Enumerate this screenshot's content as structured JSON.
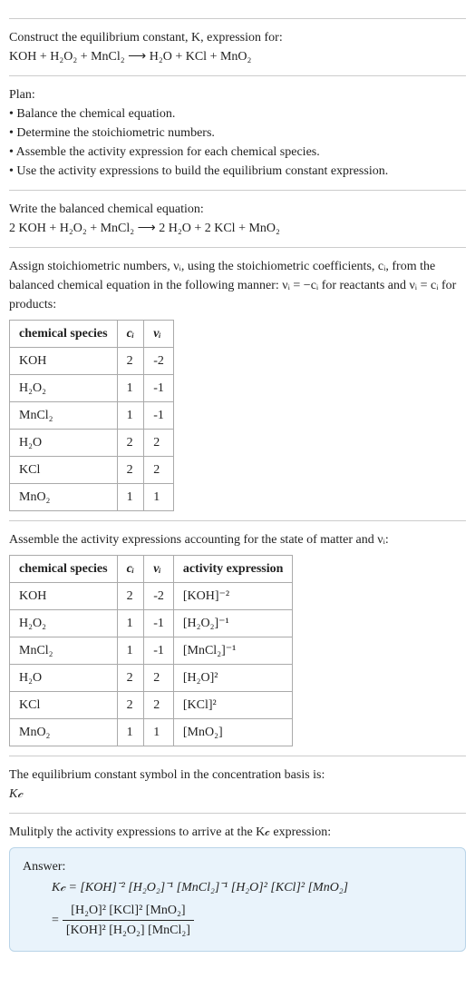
{
  "intro": {
    "line1": "Construct the equilibrium constant, K, expression for:",
    "reaction_unbal": "KOH + H₂O₂ + MnCl₂ ⟶ H₂O + KCl + MnO₂"
  },
  "plan": {
    "title": "Plan:",
    "bullets": [
      "Balance the chemical equation.",
      "Determine the stoichiometric numbers.",
      "Assemble the activity expression for each chemical species.",
      "Use the activity expressions to build the equilibrium constant expression."
    ]
  },
  "balanced": {
    "title": "Write the balanced chemical equation:",
    "equation": "2 KOH + H₂O₂ + MnCl₂ ⟶ 2 H₂O + 2 KCl + MnO₂"
  },
  "stoich": {
    "intro": "Assign stoichiometric numbers, νᵢ, using the stoichiometric coefficients, cᵢ, from the balanced chemical equation in the following manner: νᵢ = −cᵢ for reactants and νᵢ = cᵢ for products:",
    "headers": [
      "chemical species",
      "cᵢ",
      "νᵢ"
    ],
    "rows": [
      {
        "species": "KOH",
        "c": "2",
        "v": "-2"
      },
      {
        "species": "H₂O₂",
        "c": "1",
        "v": "-1"
      },
      {
        "species": "MnCl₂",
        "c": "1",
        "v": "-1"
      },
      {
        "species": "H₂O",
        "c": "2",
        "v": "2"
      },
      {
        "species": "KCl",
        "c": "2",
        "v": "2"
      },
      {
        "species": "MnO₂",
        "c": "1",
        "v": "1"
      }
    ]
  },
  "activity": {
    "intro": "Assemble the activity expressions accounting for the state of matter and νᵢ:",
    "headers": [
      "chemical species",
      "cᵢ",
      "νᵢ",
      "activity expression"
    ],
    "rows": [
      {
        "species": "KOH",
        "c": "2",
        "v": "-2",
        "expr": "[KOH]⁻²"
      },
      {
        "species": "H₂O₂",
        "c": "1",
        "v": "-1",
        "expr": "[H₂O₂]⁻¹"
      },
      {
        "species": "MnCl₂",
        "c": "1",
        "v": "-1",
        "expr": "[MnCl₂]⁻¹"
      },
      {
        "species": "H₂O",
        "c": "2",
        "v": "2",
        "expr": "[H₂O]²"
      },
      {
        "species": "KCl",
        "c": "2",
        "v": "2",
        "expr": "[KCl]²"
      },
      {
        "species": "MnO₂",
        "c": "1",
        "v": "1",
        "expr": "[MnO₂]"
      }
    ]
  },
  "symbol": {
    "line1": "The equilibrium constant symbol in the concentration basis is:",
    "line2": "K𝒸"
  },
  "multiply": {
    "intro": "Mulitply the activity expressions to arrive at the K𝒸 expression:"
  },
  "answer": {
    "title": "Answer:",
    "product_line": "K𝒸 = [KOH]⁻² [H₂O₂]⁻¹ [MnCl₂]⁻¹ [H₂O]² [KCl]² [MnO₂]",
    "frac_eq": "= ",
    "frac_num": "[H₂O]² [KCl]² [MnO₂]",
    "frac_den": "[KOH]² [H₂O₂] [MnCl₂]"
  }
}
